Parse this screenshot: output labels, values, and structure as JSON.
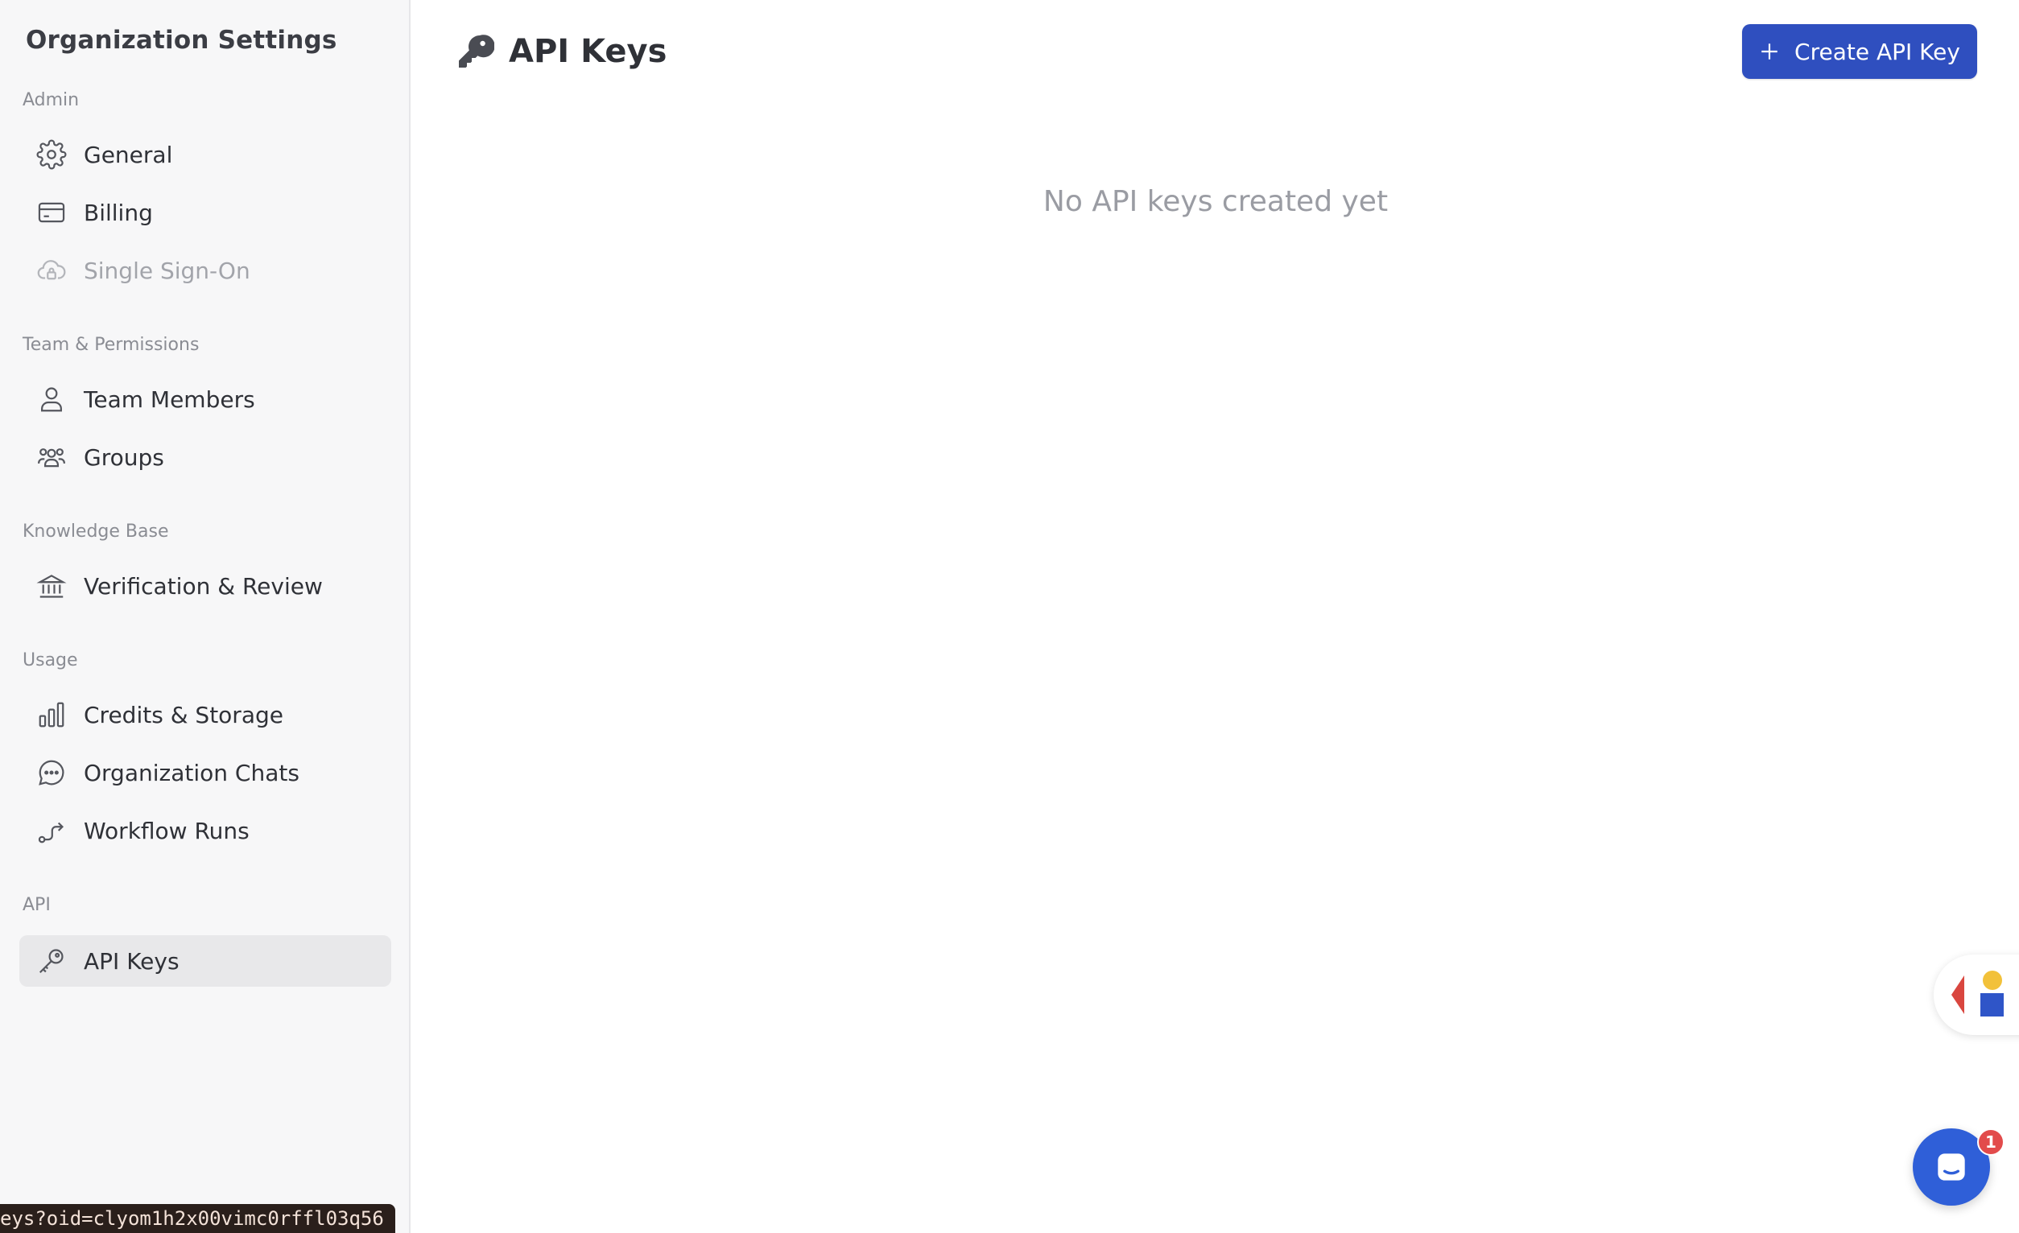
{
  "sidebar": {
    "title": "Organization Settings",
    "sections": [
      {
        "label": "Admin"
      },
      {
        "label": "Team & Permissions"
      },
      {
        "label": "Knowledge Base"
      },
      {
        "label": "Usage"
      },
      {
        "label": "API"
      }
    ],
    "items": [
      {
        "label": "General",
        "icon": "gear-icon"
      },
      {
        "label": "Billing",
        "icon": "credit-card-icon"
      },
      {
        "label": "Single Sign-On",
        "icon": "cloud-lock-icon",
        "disabled": true
      },
      {
        "label": "Team Members",
        "icon": "user-icon"
      },
      {
        "label": "Groups",
        "icon": "users-group-icon"
      },
      {
        "label": "Verification & Review",
        "icon": "bank-icon"
      },
      {
        "label": "Credits & Storage",
        "icon": "bar-chart-icon"
      },
      {
        "label": "Organization Chats",
        "icon": "chat-bubble-icon"
      },
      {
        "label": "Workflow Runs",
        "icon": "route-icon"
      },
      {
        "label": "API Keys",
        "icon": "key-icon",
        "active": true
      }
    ]
  },
  "header": {
    "title": "API Keys",
    "icon": "key-icon",
    "create_label": "Create API Key"
  },
  "main": {
    "empty_message": "No API keys created yet"
  },
  "widgets": {
    "chat_badge_count": "1"
  },
  "status_bar": {
    "url": "eys?oid=clyom1h2x00vimc0rffl03q56"
  },
  "colors": {
    "primary": "#2f4fbf",
    "sidebar_bg": "#f7f7f8",
    "active_item_bg": "#e8e8ea",
    "chat_fab": "#2f5fd8",
    "badge": "#e24b4b"
  }
}
